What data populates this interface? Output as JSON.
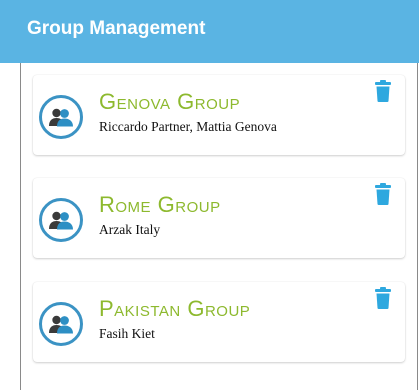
{
  "appbar": {
    "title": "Group Management"
  },
  "colors": {
    "appbar": "#5ab4e3",
    "group_name": "#8db92e",
    "accent": "#3b93c4",
    "trash": "#2ea8df"
  },
  "groups": [
    {
      "name": "Genova Group",
      "members": "Riccardo Partner, Mattia Genova",
      "avatar_icon": "group-users-icon",
      "action_icon": "trash-icon"
    },
    {
      "name": "Rome Group",
      "members": "Arzak Italy",
      "avatar_icon": "group-users-icon",
      "action_icon": "trash-icon"
    },
    {
      "name": "Pakistan Group",
      "members": "Fasih Kiet",
      "avatar_icon": "group-users-icon",
      "action_icon": "trash-icon"
    }
  ]
}
